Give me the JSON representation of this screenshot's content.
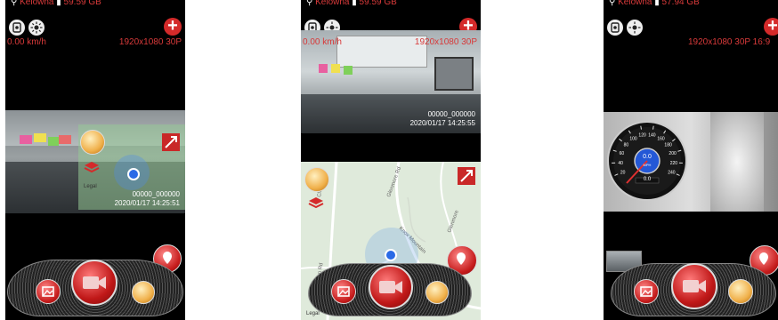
{
  "phones": [
    {
      "location": "Kelowna",
      "storage": "59.59 GB",
      "speed": "0.00 km/h",
      "resolution": "1920x1080 30P",
      "frame_id": "00000_000000",
      "timestamp": "2020/01/17 14:25:51",
      "map_label": "Legal"
    },
    {
      "location": "Kelowna",
      "storage": "59.59 GB",
      "speed": "0.00 km/h",
      "resolution": "1920x1080 30P",
      "frame_id": "00000_000000",
      "timestamp": "2020/01/17 14:25:55",
      "map_label": "Legal",
      "street_labels": [
        "Clifton Rd",
        "Glenmore Rd",
        "Knox Mountain",
        "Clifton Rd",
        "Glenmore"
      ]
    },
    {
      "location": "Kelowna",
      "storage": "57.94 GB",
      "resolution": "1920x1080 30P 16:9",
      "gauge": {
        "ticks": [
          "20",
          "40",
          "60",
          "80",
          "100",
          "120",
          "140",
          "160",
          "180",
          "200",
          "220",
          "240"
        ],
        "speed": "0.0",
        "unit": "MPH",
        "odometer": "0.0",
        "value_mph": 0
      }
    }
  ],
  "colors": {
    "accent": "#d83a3a",
    "button_red": "#c01818",
    "map_green": "#dfeadb"
  }
}
